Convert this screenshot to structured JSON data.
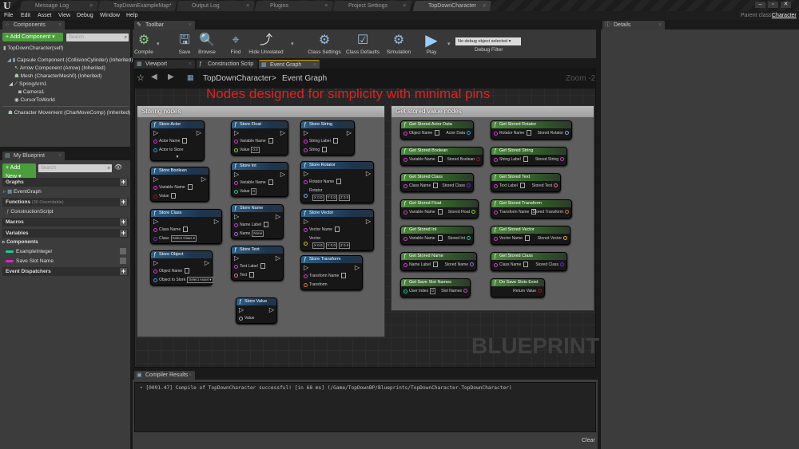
{
  "window": {
    "doc_tabs": [
      {
        "label": "Message Log",
        "icon": "message-log-icon"
      },
      {
        "label": "TopDownExampleMap*",
        "icon": "map-icon"
      },
      {
        "label": "Output Log",
        "icon": "output-log-icon"
      },
      {
        "label": "Plugins",
        "icon": "plugin-icon"
      },
      {
        "label": "Project Settings",
        "icon": "settings-icon"
      },
      {
        "label": "TopDownCharacter",
        "icon": "blueprint-icon",
        "active": true
      }
    ],
    "menu": [
      "File",
      "Edit",
      "Asset",
      "View",
      "Debug",
      "Window",
      "Help"
    ],
    "parent_class_label": "Parent class:",
    "parent_class_value": "Character",
    "window_controls": [
      "–",
      "▫",
      "✕"
    ]
  },
  "components_panel": {
    "tab": "Components",
    "add_button": "+ Add Component ▾",
    "search_placeholder": "Search",
    "items": [
      {
        "label": "TopDownCharacter(self)",
        "indent": 0
      },
      {
        "label": "Capsule Component (CollisionCylinder) (Inherited)",
        "indent": 1
      },
      {
        "label": "Arrow Component (Arrow) (Inherited)",
        "indent": 2
      },
      {
        "label": "Mesh (CharacterMesh0) (Inherited)",
        "indent": 2
      },
      {
        "label": "SpringArm1",
        "indent": 1
      },
      {
        "label": "Camera1",
        "indent": 3
      },
      {
        "label": "CursorToWorld",
        "indent": 2
      },
      {
        "label": "Character Movement (CharMoveComp) (Inherited)",
        "indent": 0
      }
    ]
  },
  "my_blueprint": {
    "tab": "My Blueprint",
    "add_button": "+ Add New ▾",
    "search_placeholder": "Search",
    "sections": {
      "graphs": "Graphs",
      "event_graph": "EventGraph",
      "functions": "Functions",
      "functions_note": "(30 Overridable)",
      "construction_script": "ConstructionScript",
      "macros": "Macros",
      "variables": "Variables",
      "components": "Components",
      "event_dispatchers": "Event Dispatchers"
    },
    "variables": [
      {
        "name": "ExampleInteger",
        "color": "#1fc79a"
      },
      {
        "name": "Save Slot Name",
        "color": "#e020d0"
      }
    ]
  },
  "toolbar": {
    "tab": "Toolbar",
    "buttons": [
      {
        "label": "Compile",
        "icon": "compile-icon"
      },
      {
        "label": "Save",
        "icon": "save-icon"
      },
      {
        "label": "Browse",
        "icon": "browse-icon"
      },
      {
        "label": "Find",
        "icon": "find-icon"
      },
      {
        "label": "Hide Unrelated",
        "icon": "hide-unrelated-icon"
      },
      {
        "label": "Class Settings",
        "icon": "class-settings-icon"
      },
      {
        "label": "Class Defaults",
        "icon": "class-defaults-icon"
      },
      {
        "label": "Simulation",
        "icon": "simulation-icon"
      },
      {
        "label": "Play",
        "icon": "play-icon"
      }
    ],
    "debug_select": "No debug object selected ▾",
    "debug_label": "Debug Filter"
  },
  "editor_tabs": [
    {
      "label": "Viewport"
    },
    {
      "label": "Construction Scrip"
    },
    {
      "label": "Event Graph",
      "active": true
    }
  ],
  "graph": {
    "breadcrumb_root": "TopDownCharacter",
    "breadcrumb_sep": ">",
    "breadcrumb_current": "Event Graph",
    "zoom": "Zoom -2",
    "headline": "Nodes designed for simplicity with minimal pins",
    "watermark": "BLUEPRINT",
    "comment_left": "Storing nodes",
    "comment_right": "Get stored value nodes",
    "store_nodes": [
      {
        "title": "Store Actor",
        "pins": [
          {
            "label": "Actor Name",
            "type": "text",
            "color": "#d23bd2"
          },
          {
            "label": "Actor to Store",
            "color": "#2aa0e0"
          }
        ]
      },
      {
        "title": "Store Boolean",
        "pins": [
          {
            "label": "Variable Name",
            "type": "text",
            "color": "#d23bd2"
          },
          {
            "label": "Value",
            "type": "check",
            "color": "#a01010"
          }
        ]
      },
      {
        "title": "Store Class",
        "pins": [
          {
            "label": "Class Name",
            "type": "text",
            "color": "#d23bd2"
          },
          {
            "label": "Class",
            "value": "Select Class ▾",
            "color": "#6a2ad0"
          }
        ]
      },
      {
        "title": "Store Object",
        "pins": [
          {
            "label": "Object Name",
            "type": "text",
            "color": "#d23bd2"
          },
          {
            "label": "Object to Store",
            "value": "Select Asset ▾",
            "color": "#2aa0e0"
          }
        ]
      },
      {
        "title": "Store Float",
        "pins": [
          {
            "label": "Variable Name",
            "type": "text",
            "color": "#d23bd2"
          },
          {
            "label": "Value",
            "value": "0.0",
            "color": "#8cd23a"
          }
        ]
      },
      {
        "title": "Store Int",
        "pins": [
          {
            "label": "Variable Name",
            "type": "text",
            "color": "#d23bd2"
          },
          {
            "label": "Value",
            "value": "0",
            "color": "#1fc79a"
          }
        ]
      },
      {
        "title": "Store Name",
        "pins": [
          {
            "label": "Name Label",
            "type": "text",
            "color": "#d23bd2"
          },
          {
            "label": "Name",
            "value": "None",
            "color": "#a070e0"
          }
        ]
      },
      {
        "title": "Store Text",
        "pins": [
          {
            "label": "Text Label",
            "type": "text",
            "color": "#d23bd2"
          },
          {
            "label": "Text",
            "type": "text",
            "color": "#e070a0"
          }
        ]
      },
      {
        "title": "Store Value",
        "pins": [
          {
            "label": "Value",
            "color": "#aaaaaa"
          }
        ]
      },
      {
        "title": "Store String",
        "pins": [
          {
            "label": "String Label",
            "type": "text",
            "color": "#d23bd2"
          },
          {
            "label": "String",
            "type": "text",
            "color": "#d23bd2"
          }
        ]
      },
      {
        "title": "Store Rotator",
        "pins": [
          {
            "label": "Rotator Name",
            "type": "text",
            "color": "#d23bd2"
          },
          {
            "label": "Rotator",
            "xyz": [
              "X 0.0",
              "Y 0.0",
              "Z 0.0"
            ],
            "color": "#8aa0e0"
          }
        ]
      },
      {
        "title": "Store Vector",
        "pins": [
          {
            "label": "Vector Name",
            "type": "text",
            "color": "#d23bd2"
          },
          {
            "label": "Vector",
            "xyz": [
              "X 0.0",
              "Y 0.0",
              "Z 0.0"
            ],
            "color": "#e0b020"
          }
        ]
      },
      {
        "title": "Store Transform",
        "pins": [
          {
            "label": "Transform Name",
            "type": "text",
            "color": "#d23bd2"
          },
          {
            "label": "Transform",
            "color": "#e07020"
          }
        ]
      }
    ],
    "get_nodes": [
      {
        "title": "Get Stored Actor Data",
        "in": "Object Name",
        "out": "Actor Data",
        "in_color": "#d23bd2",
        "out_color": "#2aa0e0"
      },
      {
        "title": "Get Stored Boolean",
        "in": "Variable Name",
        "out": "Stored Boolean",
        "in_color": "#d23bd2",
        "out_color": "#a01010"
      },
      {
        "title": "Get Stored Class",
        "in": "Class Name",
        "out": "Stored Class",
        "in_color": "#d23bd2",
        "out_color": "#6a2ad0"
      },
      {
        "title": "Get Stored Float",
        "in": "Variable Name",
        "out": "Stored Float",
        "in_color": "#d23bd2",
        "out_color": "#8cd23a"
      },
      {
        "title": "Get Stored Int",
        "in": "Variable Name",
        "out": "Stored Int",
        "in_color": "#d23bd2",
        "out_color": "#1fc79a"
      },
      {
        "title": "Get Stored Name",
        "in": "Name Label",
        "out": "Stored Name",
        "in_color": "#d23bd2",
        "out_color": "#a070e0"
      },
      {
        "title": "Get Save Slot Names",
        "in": "User Index",
        "in_value": "0",
        "out": "Slot Names",
        "in_color": "#1fc79a",
        "out_color": "#d23bd2"
      },
      {
        "title": "Get Stored Rotator",
        "in": "Rotator Name",
        "out": "Stored Rotator",
        "in_color": "#d23bd2",
        "out_color": "#8aa0e0"
      },
      {
        "title": "Get Stored String",
        "in": "String Label",
        "out": "Stored String",
        "in_color": "#d23bd2",
        "out_color": "#d23bd2"
      },
      {
        "title": "Get Stored Text",
        "in": "Text Label",
        "out": "Stored Text",
        "in_color": "#d23bd2",
        "out_color": "#e070a0"
      },
      {
        "title": "Get Stored Transform",
        "in": "Transform Name",
        "out": "Stored Transform",
        "in_color": "#d23bd2",
        "out_color": "#e07020"
      },
      {
        "title": "Get Stored Vector",
        "in": "Vector Name",
        "out": "Stored Vector",
        "in_color": "#d23bd2",
        "out_color": "#e0b020"
      },
      {
        "title": "Get Stored Class",
        "in": "Class Name",
        "out": "Stored Class",
        "in_color": "#d23bd2",
        "out_color": "#6a2ad0"
      },
      {
        "title": "Do Save Slots Exist",
        "out": "Return Value",
        "out_color": "#a01010"
      }
    ]
  },
  "compiler_results": {
    "tab": "Compiler Results",
    "log": "[0091.47] Compile of TopDownCharacter successful! [in 68 ms] (/Game/TopDownBP/Blueprints/TopDownCharacter.TopDownCharacter)",
    "clear": "Clear"
  },
  "details": {
    "tab": "Details"
  }
}
